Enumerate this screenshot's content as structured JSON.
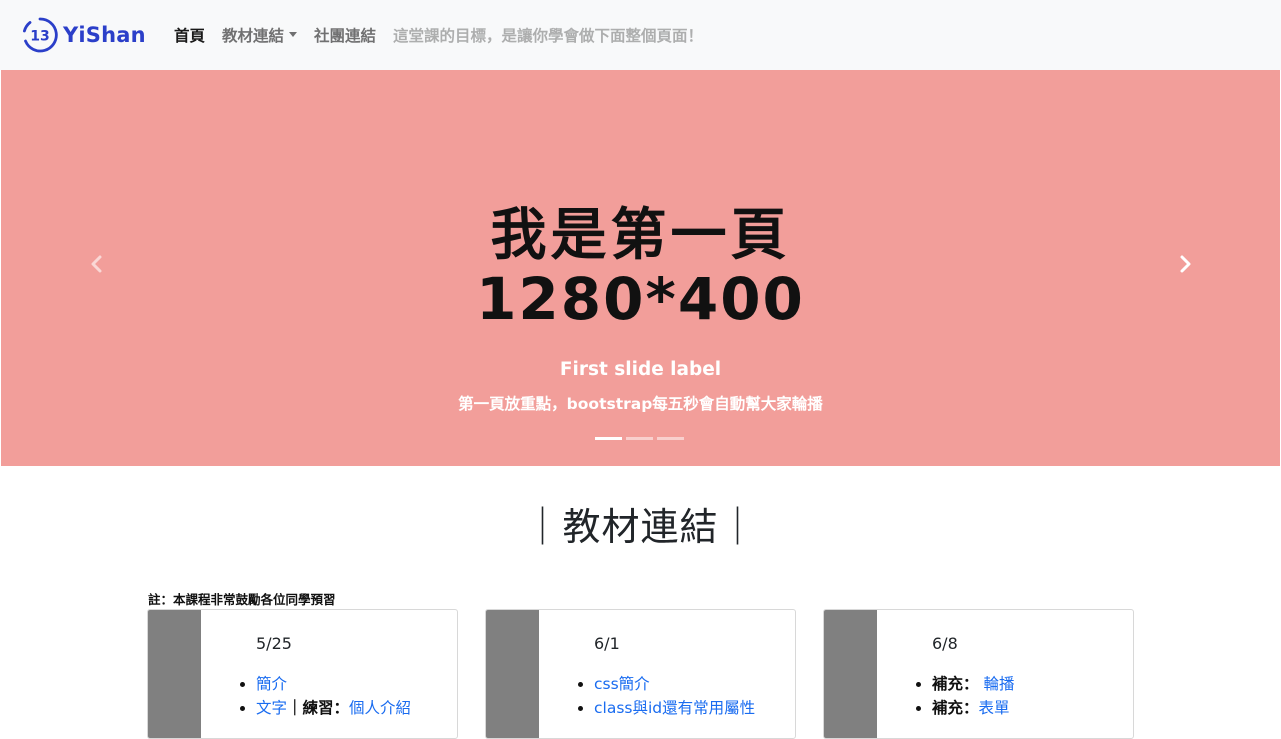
{
  "navbar": {
    "brand_logo_text": "13",
    "brand_name": "YiShan",
    "links": {
      "home": "首頁",
      "materials": "教材連結",
      "club": "社團連結"
    },
    "tagline": "這堂課的目標，是讓你學會做下面整個頁面！"
  },
  "carousel": {
    "slide_line1": "我是第一頁",
    "slide_line2": "1280*400",
    "caption_title": "First slide label",
    "caption_text": "第一頁放重點，bootstrap每五秒會自動幫大家輪播",
    "indicator_count": 3,
    "active_index": 0,
    "background_color": "#f29e9a"
  },
  "section": {
    "title": "｜教材連結｜",
    "note": "註：本課程非常鼓勵各位同學預習"
  },
  "cards": [
    {
      "date": "5/25",
      "item1_link": "簡介",
      "item2_link": "文字",
      "item2_sep": "｜練習：",
      "item2_link2": "個人介紹"
    },
    {
      "date": "6/1",
      "item1_link": "css簡介",
      "item2_link": "class與id還有常用屬性"
    },
    {
      "date": "6/8",
      "item1_prefix": "補充：",
      "item1_link": "輪播",
      "item2_prefix": "補充：",
      "item2_link": "表單"
    }
  ],
  "colors": {
    "brand": "#2b3fc9",
    "link": "#1a6cf0",
    "navbar_bg": "#f8f9fa"
  }
}
